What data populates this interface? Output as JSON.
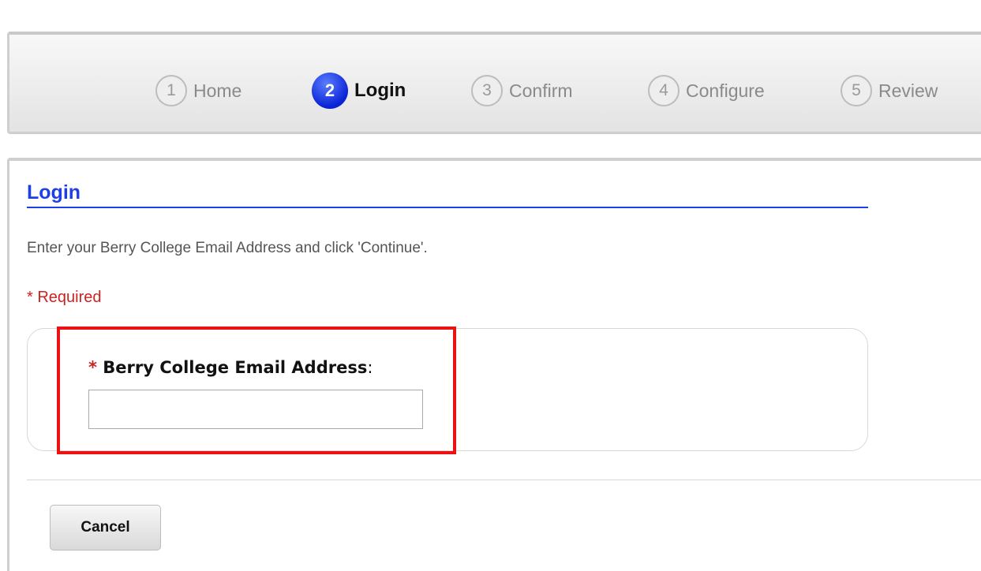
{
  "wizard": {
    "steps": [
      {
        "number": "1",
        "label": "Home",
        "active": false
      },
      {
        "number": "2",
        "label": "Login",
        "active": true
      },
      {
        "number": "3",
        "label": "Confirm",
        "active": false
      },
      {
        "number": "4",
        "label": "Configure",
        "active": false
      },
      {
        "number": "5",
        "label": "Review",
        "active": false
      }
    ]
  },
  "login": {
    "title": "Login",
    "instructions": "Enter your Berry College Email Address and click 'Continue'.",
    "required_note": "* Required",
    "field": {
      "required_marker": "*",
      "label": "Berry College Email Address",
      "label_suffix": ":",
      "value": "",
      "placeholder": ""
    }
  },
  "actions": {
    "cancel_label": "Cancel"
  },
  "colors": {
    "accent": "#1f3fe6",
    "required": "#cc2222",
    "highlight": "#ee1111"
  }
}
